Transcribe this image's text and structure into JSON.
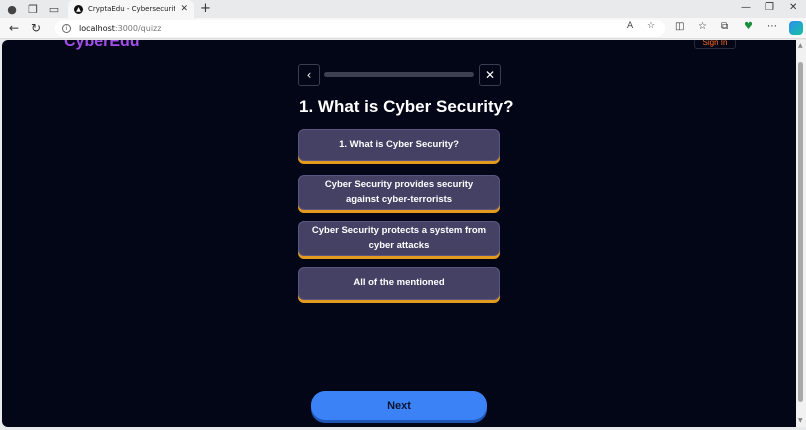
{
  "browser": {
    "tab_title": "CryptaEdu - Cybersecurity Prevention",
    "tab_favicon_glyph": "▲",
    "url_host": "localhost",
    "url_path": ":3000/quizz",
    "icons": [
      "profile-icon",
      "workspaces-icon",
      "tab-actions-icon",
      "new-tab-icon",
      "back-icon",
      "refresh-icon",
      "info-icon",
      "read-aloud-icon",
      "favorite-icon",
      "split-screen-icon",
      "favorites-icon",
      "collections-icon",
      "browser-essentials-icon",
      "more-icon",
      "copilot-icon"
    ]
  },
  "site": {
    "brand": "CyberEdu",
    "signin_label": "Sign In",
    "brand_color": "#a24ee8",
    "signin_color": "#ff6a1a"
  },
  "quiz": {
    "progress_fraction": 0.0,
    "question": "1. What is Cyber Security?",
    "options": [
      "1. What is Cyber Security?",
      "Cyber Security provides security against cyber-terrorists",
      "Cyber Security protects a system from cyber attacks",
      "All of the mentioned"
    ],
    "next_label": "Next",
    "option_color": "#454165",
    "option_accent": "#e39a1d",
    "next_color": "#3b82f6"
  }
}
